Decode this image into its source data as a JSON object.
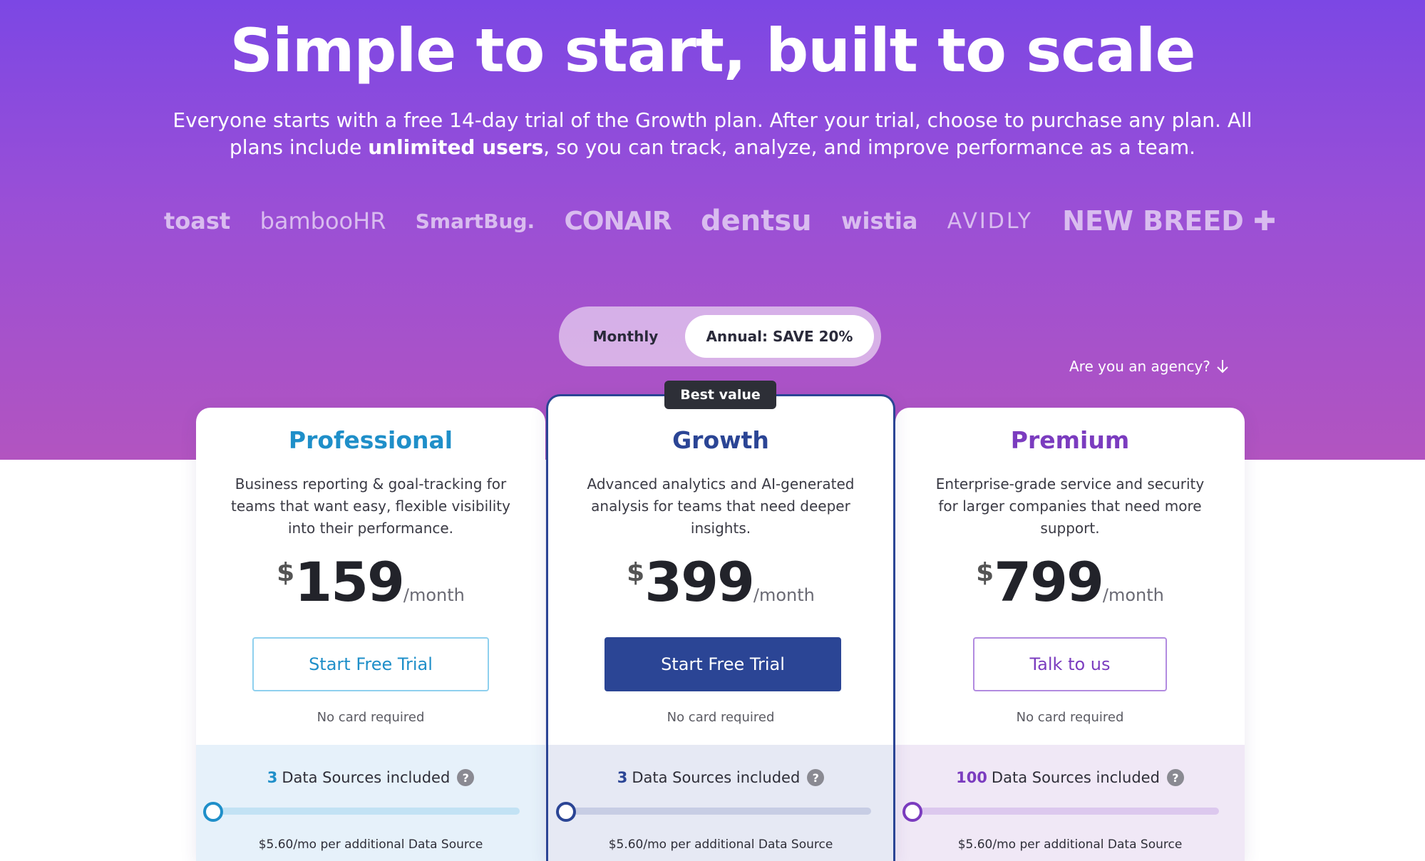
{
  "hero": {
    "title": "Simple to start, built to scale",
    "subtitle_part1": "Everyone starts with a free 14-day trial of the Growth plan. After your trial, choose to purchase any plan. All plans include ",
    "subtitle_bold": "unlimited users",
    "subtitle_part2": ", so you can track, analyze, and improve performance as a team."
  },
  "logos": [
    "toast",
    "bambooHR",
    "SmartBug.",
    "CONAIR",
    "dentsu",
    "wistia",
    "AVIDLY",
    "NEW BREED"
  ],
  "billing_toggle": {
    "monthly_label": "Monthly",
    "annual_label": "Annual: SAVE 20%",
    "selected": "annual"
  },
  "agency_link": "Are you an agency?",
  "badge": "Best value",
  "plans": [
    {
      "name": "Professional",
      "description": "Business reporting & goal-tracking for teams that want easy, flexible visibility into their performance.",
      "currency": "$",
      "price": "159",
      "period": "/month",
      "cta": "Start Free Trial",
      "note": "No card required",
      "data_sources_count": "3",
      "data_sources_label": "Data Sources included",
      "slider_value": 0,
      "additional": "$5.60/mo per additional Data Source",
      "accent": "#1f8fc9"
    },
    {
      "name": "Growth",
      "description": "Advanced analytics and AI-generated analysis for teams that need deeper insights.",
      "currency": "$",
      "price": "399",
      "period": "/month",
      "cta": "Start Free Trial",
      "note": "No card required",
      "data_sources_count": "3",
      "data_sources_label": "Data Sources included",
      "slider_value": 0,
      "additional": "$5.60/mo per additional Data Source",
      "accent": "#2b4595"
    },
    {
      "name": "Premium",
      "description": "Enterprise-grade service and security for larger companies that need more support.",
      "currency": "$",
      "price": "799",
      "period": "/month",
      "cta": "Talk to us",
      "note": "No card required",
      "data_sources_count": "100",
      "data_sources_label": "Data Sources included",
      "slider_value": 0,
      "additional": "$5.60/mo per additional Data Source",
      "accent": "#7b3cbf"
    }
  ],
  "icons": {
    "help": "question-circle-icon",
    "arrow": "arrow-down-icon"
  }
}
